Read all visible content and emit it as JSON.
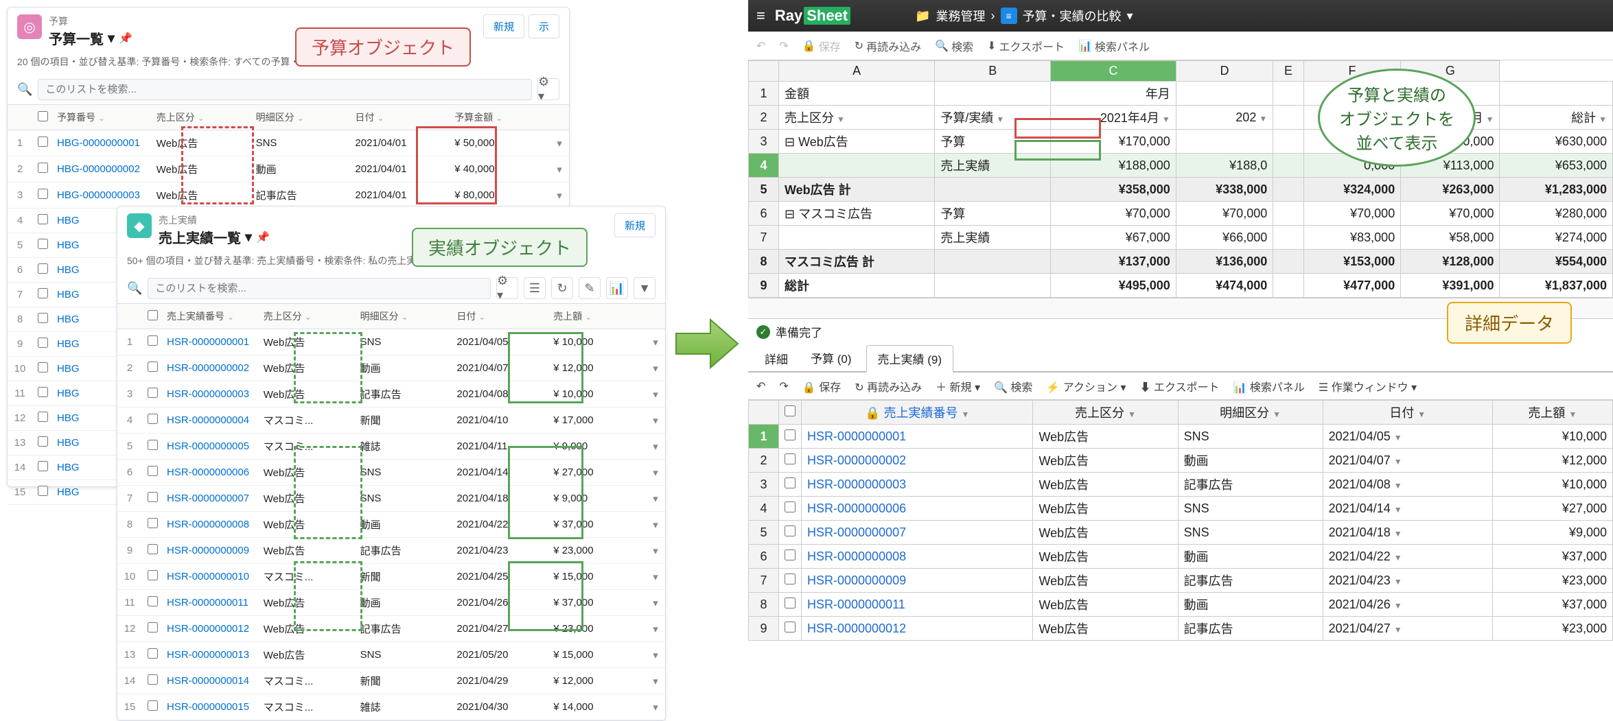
{
  "left": {
    "budget": {
      "small_title": "予算",
      "title": "予算一覧",
      "icon_color": "#e583b9",
      "meta": "20 個の項目・並び替え基準: 予算番号・検索条件: すべての予算・1分前 に更新されました",
      "search_placeholder": "このリストを検索...",
      "btn_new": "新規",
      "btn_display": "示",
      "cols": [
        "予算番号",
        "売上区分",
        "明細区分",
        "日付",
        "予算金額"
      ],
      "rows": [
        {
          "n": 1,
          "id": "HBG-0000000001",
          "cat": "Web広告",
          "sub": "SNS",
          "date": "2021/04/01",
          "amt": "¥ 50,000"
        },
        {
          "n": 2,
          "id": "HBG-0000000002",
          "cat": "Web広告",
          "sub": "動画",
          "date": "2021/04/01",
          "amt": "¥ 40,000"
        },
        {
          "n": 3,
          "id": "HBG-0000000003",
          "cat": "Web広告",
          "sub": "記事広告",
          "date": "2021/04/01",
          "amt": "¥ 80,000"
        },
        {
          "n": 4,
          "id": "HBG"
        },
        {
          "n": 5,
          "id": "HBG"
        },
        {
          "n": 6,
          "id": "HBG"
        },
        {
          "n": 7,
          "id": "HBG"
        },
        {
          "n": 8,
          "id": "HBG"
        },
        {
          "n": 9,
          "id": "HBG"
        },
        {
          "n": 10,
          "id": "HBG"
        },
        {
          "n": 11,
          "id": "HBG"
        },
        {
          "n": 12,
          "id": "HBG"
        },
        {
          "n": 13,
          "id": "HBG"
        },
        {
          "n": 14,
          "id": "HBG"
        },
        {
          "n": 15,
          "id": "HBG"
        }
      ]
    },
    "actual": {
      "small_title": "売上実績",
      "title": "売上実績一覧",
      "icon_color": "#3cc2b0",
      "meta": "50+ 個の項目・並び替え基準: 売上実績番号・検索条件: 私の売上実績・1分前 に更新されました",
      "search_placeholder": "このリストを検索...",
      "btn_new": "新規",
      "cols": [
        "売上実績番号",
        "売上区分",
        "明細区分",
        "日付",
        "売上額"
      ],
      "rows": [
        {
          "n": 1,
          "id": "HSR-0000000001",
          "cat": "Web広告",
          "sub": "SNS",
          "date": "2021/04/05",
          "amt": "¥ 10,000"
        },
        {
          "n": 2,
          "id": "HSR-0000000002",
          "cat": "Web広告",
          "sub": "動画",
          "date": "2021/04/07",
          "amt": "¥ 12,000"
        },
        {
          "n": 3,
          "id": "HSR-0000000003",
          "cat": "Web広告",
          "sub": "記事広告",
          "date": "2021/04/08",
          "amt": "¥ 10,000"
        },
        {
          "n": 4,
          "id": "HSR-0000000004",
          "cat": "マスコミ...",
          "sub": "新聞",
          "date": "2021/04/10",
          "amt": "¥ 17,000"
        },
        {
          "n": 5,
          "id": "HSR-0000000005",
          "cat": "マスコミ...",
          "sub": "雑誌",
          "date": "2021/04/11",
          "amt": "¥ 9,000"
        },
        {
          "n": 6,
          "id": "HSR-0000000006",
          "cat": "Web広告",
          "sub": "SNS",
          "date": "2021/04/14",
          "amt": "¥ 27,000"
        },
        {
          "n": 7,
          "id": "HSR-0000000007",
          "cat": "Web広告",
          "sub": "SNS",
          "date": "2021/04/18",
          "amt": "¥ 9,000"
        },
        {
          "n": 8,
          "id": "HSR-0000000008",
          "cat": "Web広告",
          "sub": "動画",
          "date": "2021/04/22",
          "amt": "¥ 37,000"
        },
        {
          "n": 9,
          "id": "HSR-0000000009",
          "cat": "Web広告",
          "sub": "記事広告",
          "date": "2021/04/23",
          "amt": "¥ 23,000"
        },
        {
          "n": 10,
          "id": "HSR-0000000010",
          "cat": "マスコミ...",
          "sub": "新聞",
          "date": "2021/04/25",
          "amt": "¥ 15,000"
        },
        {
          "n": 11,
          "id": "HSR-0000000011",
          "cat": "Web広告",
          "sub": "動画",
          "date": "2021/04/26",
          "amt": "¥ 37,000"
        },
        {
          "n": 12,
          "id": "HSR-0000000012",
          "cat": "Web広告",
          "sub": "記事広告",
          "date": "2021/04/27",
          "amt": "¥ 23,000"
        },
        {
          "n": 13,
          "id": "HSR-0000000013",
          "cat": "Web広告",
          "sub": "SNS",
          "date": "2021/05/20",
          "amt": "¥ 15,000"
        },
        {
          "n": 14,
          "id": "HSR-0000000014",
          "cat": "マスコミ...",
          "sub": "新聞",
          "date": "2021/04/29",
          "amt": "¥ 12,000"
        },
        {
          "n": 15,
          "id": "HSR-0000000015",
          "cat": "マスコミ...",
          "sub": "雑誌",
          "date": "2021/04/30",
          "amt": "¥ 14,000"
        }
      ]
    },
    "callout_budget": "予算オブジェクト",
    "callout_actual": "実績オブジェクト"
  },
  "right": {
    "logo": "RaySheet",
    "breadcrumb_folder": "業務管理",
    "breadcrumb_page": "予算・実績の比較",
    "toolbar": {
      "undo": "↶",
      "redo": "↷",
      "save": "保存",
      "reload": "再読み込み",
      "search": "検索",
      "export": "エクスポート",
      "panel": "検索パネル"
    },
    "pivot": {
      "cols": [
        "",
        "A",
        "B",
        "C",
        "D",
        "E",
        "F",
        "G"
      ],
      "rows": [
        {
          "h": "1",
          "cells": [
            "金額",
            "",
            "年月",
            "",
            "",
            "",
            "",
            ""
          ]
        },
        {
          "h": "2",
          "cells": [
            "売上区分",
            "予算/実績",
            "2021年4月",
            "202",
            "",
            "",
            "1年/7月",
            "総計"
          ],
          "dd": true
        },
        {
          "h": "3",
          "cells": [
            "⊟ Web広告",
            "予算",
            "¥170,000",
            "",
            "",
            "",
            "¥150,000",
            "¥630,000"
          ]
        },
        {
          "h": "4",
          "cells": [
            "",
            "売上実績",
            "¥188,000",
            "¥188,0",
            "",
            "0,000",
            "¥113,000",
            "¥653,000"
          ],
          "sel": true
        },
        {
          "h": "5",
          "cells": [
            "Web広告 計",
            "",
            "¥358,000",
            "¥338,000",
            "",
            "¥324,000",
            "¥263,000",
            "¥1,283,000"
          ],
          "total": true
        },
        {
          "h": "6",
          "cells": [
            "⊟ マスコミ広告",
            "予算",
            "¥70,000",
            "¥70,000",
            "",
            "¥70,000",
            "¥70,000",
            "¥280,000"
          ]
        },
        {
          "h": "7",
          "cells": [
            "",
            "売上実績",
            "¥67,000",
            "¥66,000",
            "",
            "¥83,000",
            "¥58,000",
            "¥274,000"
          ]
        },
        {
          "h": "8",
          "cells": [
            "マスコミ広告 計",
            "",
            "¥137,000",
            "¥136,000",
            "",
            "¥153,000",
            "¥128,000",
            "¥554,000"
          ],
          "total": true
        },
        {
          "h": "9",
          "cells": [
            "総計",
            "",
            "¥495,000",
            "¥474,000",
            "",
            "¥477,000",
            "¥391,000",
            "¥1,837,000"
          ],
          "grand": true
        }
      ]
    },
    "status": "準備完了",
    "tabs": {
      "label": "詳細",
      "tab1": "予算 (0)",
      "tab2": "売上実績 (9)"
    },
    "detail_toolbar": {
      "save": "保存",
      "reload": "再読み込み",
      "new": "新規",
      "search": "検索",
      "action": "アクション",
      "export": "エクスポート",
      "panel": "検索パネル",
      "workwin": "作業ウィンドウ"
    },
    "detail": {
      "cols": [
        "",
        "売上実績番号",
        "売上区分",
        "明細区分",
        "日付",
        "売上額"
      ],
      "rows": [
        {
          "n": "1",
          "id": "HSR-0000000001",
          "cat": "Web広告",
          "sub": "SNS",
          "date": "2021/04/05",
          "amt": "¥10,000",
          "sel": true
        },
        {
          "n": "2",
          "id": "HSR-0000000002",
          "cat": "Web広告",
          "sub": "動画",
          "date": "2021/04/07",
          "amt": "¥12,000"
        },
        {
          "n": "3",
          "id": "HSR-0000000003",
          "cat": "Web広告",
          "sub": "記事広告",
          "date": "2021/04/08",
          "amt": "¥10,000"
        },
        {
          "n": "4",
          "id": "HSR-0000000006",
          "cat": "Web広告",
          "sub": "SNS",
          "date": "2021/04/14",
          "amt": "¥27,000"
        },
        {
          "n": "5",
          "id": "HSR-0000000007",
          "cat": "Web広告",
          "sub": "SNS",
          "date": "2021/04/18",
          "amt": "¥9,000"
        },
        {
          "n": "6",
          "id": "HSR-0000000008",
          "cat": "Web広告",
          "sub": "動画",
          "date": "2021/04/22",
          "amt": "¥37,000"
        },
        {
          "n": "7",
          "id": "HSR-0000000009",
          "cat": "Web広告",
          "sub": "記事広告",
          "date": "2021/04/23",
          "amt": "¥23,000"
        },
        {
          "n": "8",
          "id": "HSR-0000000011",
          "cat": "Web広告",
          "sub": "動画",
          "date": "2021/04/26",
          "amt": "¥37,000"
        },
        {
          "n": "9",
          "id": "HSR-0000000012",
          "cat": "Web広告",
          "sub": "記事広告",
          "date": "2021/04/27",
          "amt": "¥23,000"
        }
      ]
    },
    "oval_callout": "予算と実績の\nオブジェクトを\n並べて表示",
    "rect_callout": "詳細データ"
  }
}
